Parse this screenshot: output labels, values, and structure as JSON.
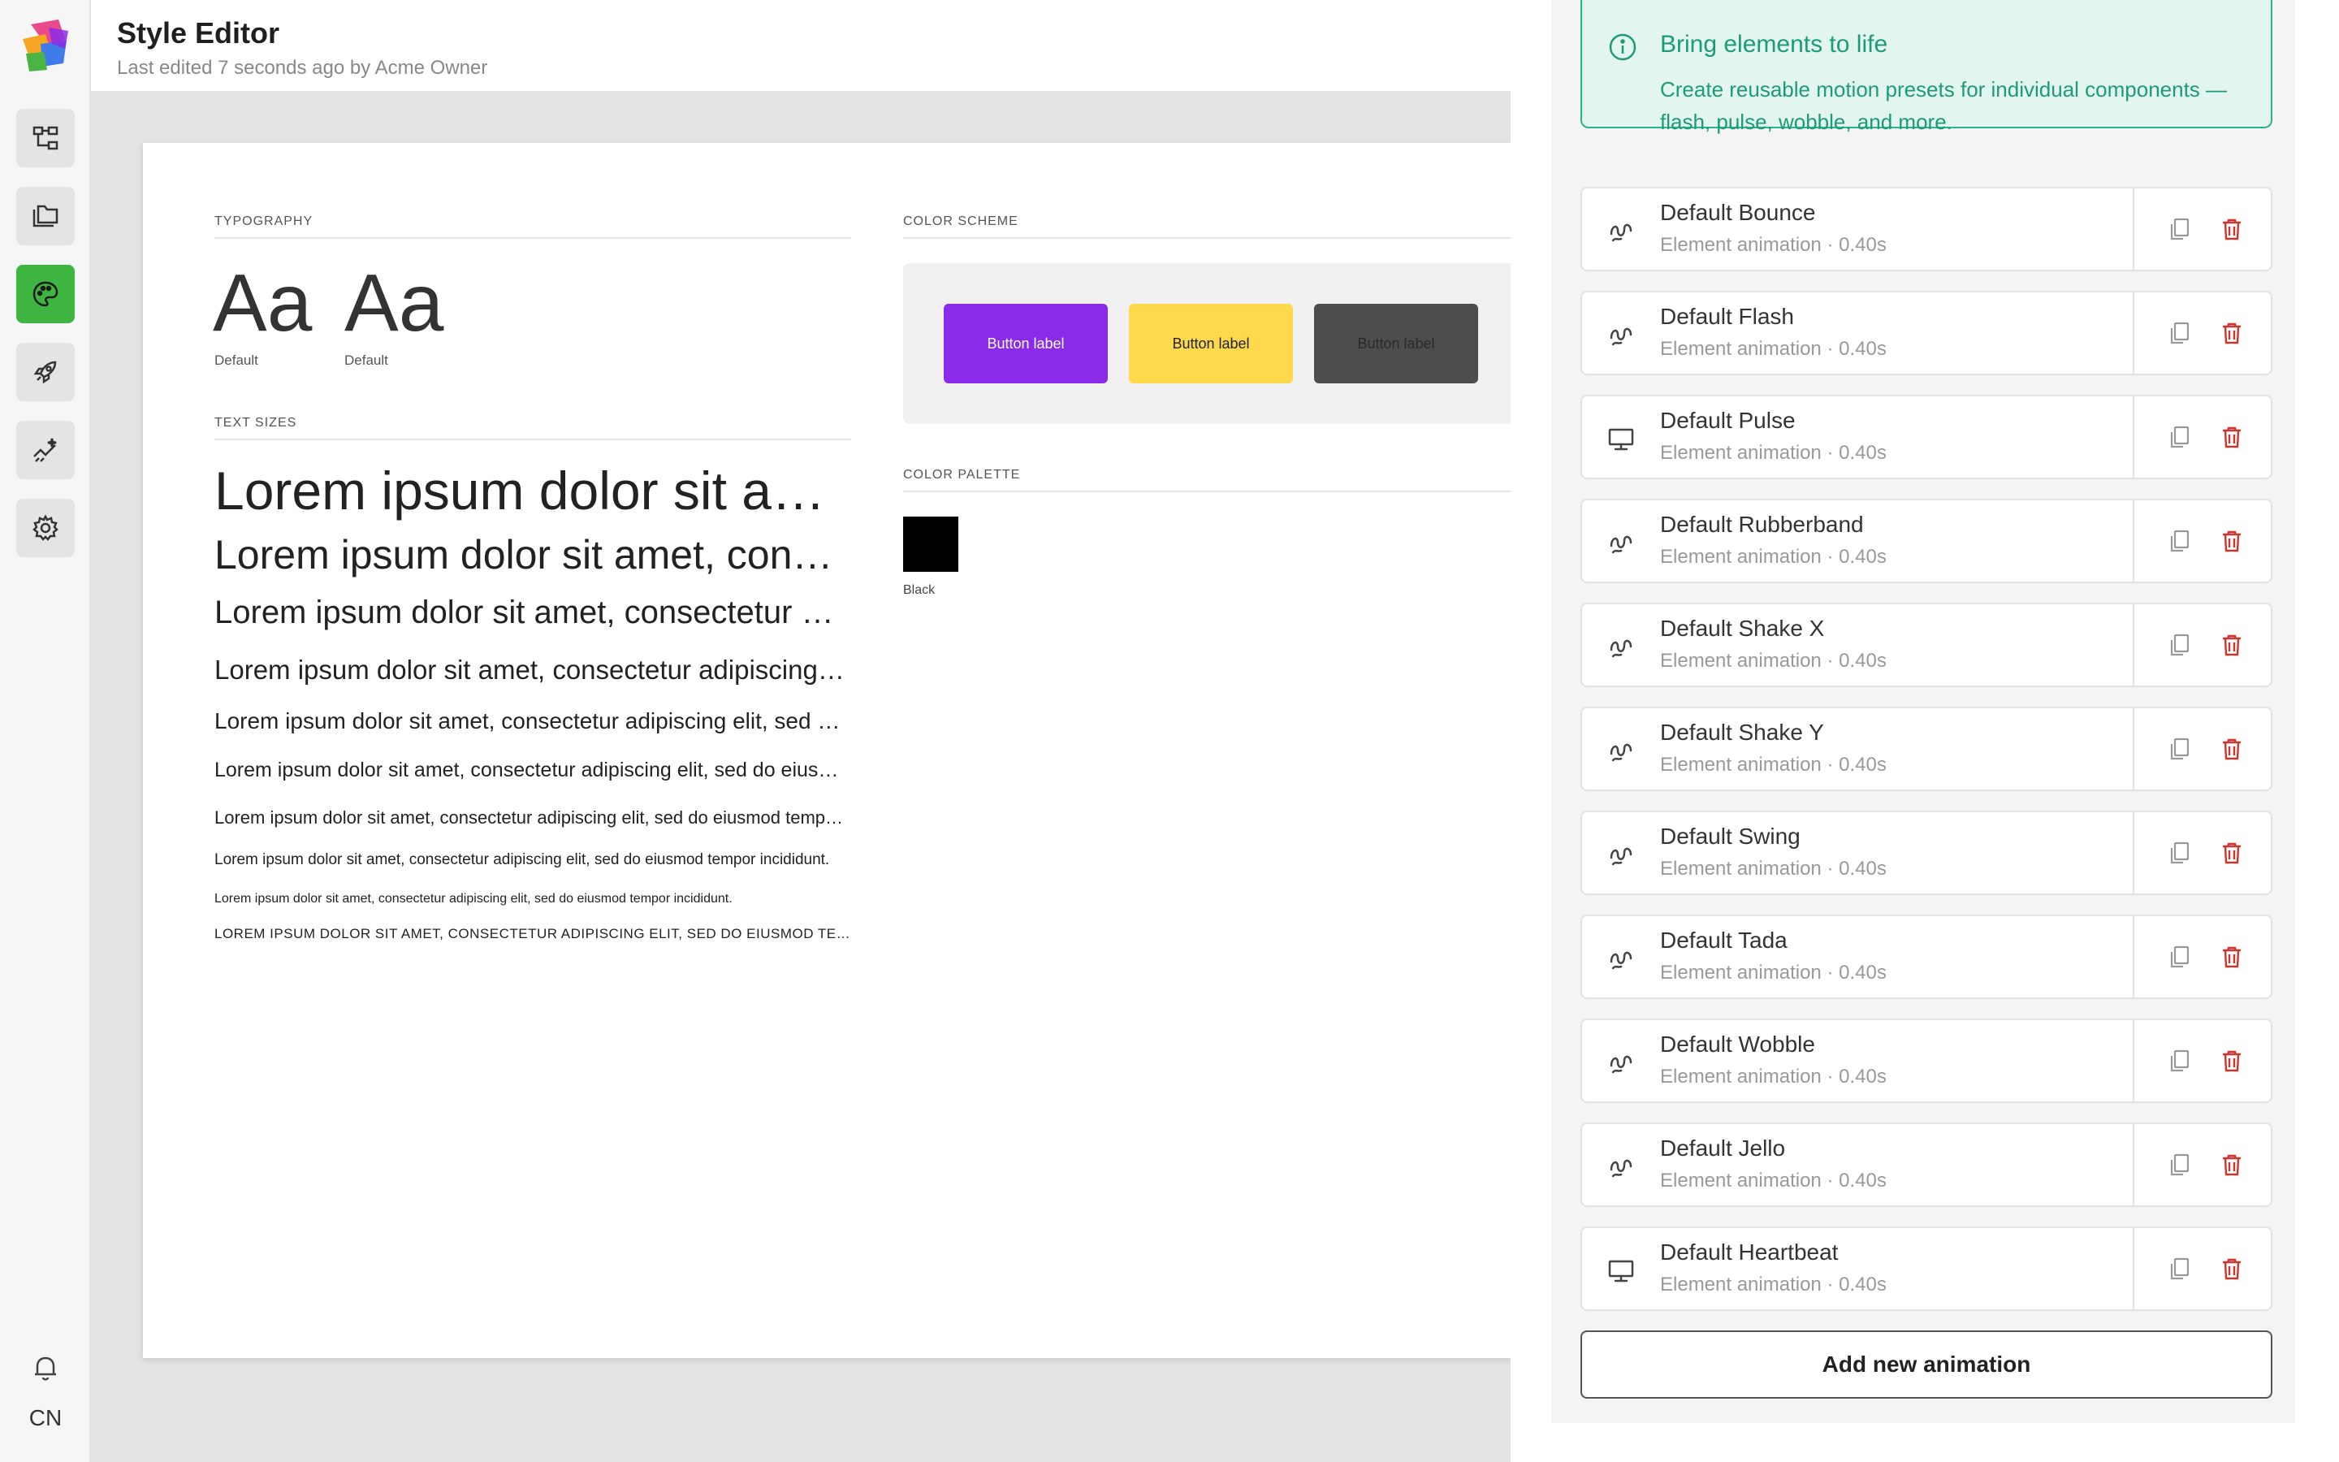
{
  "header": {
    "title": "Style Editor",
    "subtitle": "Last edited 7 seconds ago by Acme Owner"
  },
  "sidebar": {
    "items": [
      {
        "icon": "sitemap-icon"
      },
      {
        "icon": "folders-icon"
      },
      {
        "icon": "palette-icon",
        "active": true
      },
      {
        "icon": "rocket-icon"
      },
      {
        "icon": "sparkle-chart-icon"
      },
      {
        "icon": "gear-icon"
      }
    ],
    "language": "CN"
  },
  "sheet": {
    "typography_label": "TYPOGRAPHY",
    "fonts": [
      {
        "sample": "Aa",
        "caption": "Default"
      },
      {
        "sample": "Aa",
        "caption": "Default"
      }
    ],
    "text_sizes_label": "TEXT SIZES",
    "text_sizes": [
      "Lorem ipsum dolor sit amet, consectetur adipiscing elit, sed do eiusmod tempor incididunt.",
      "Lorem ipsum dolor sit amet, consectetur adipiscing elit, sed do eiusmod tempor incididunt.",
      "Lorem ipsum dolor sit amet, consectetur adipiscing elit, sed do eiusmod tempor incididunt.",
      "Lorem ipsum dolor sit amet, consectetur adipiscing elit, sed do eiusmod tempor incididunt.",
      "Lorem ipsum dolor sit amet, consectetur adipiscing elit, sed do eiusmod tempor incididunt.",
      "Lorem ipsum dolor sit amet, consectetur adipiscing elit, sed do eiusmod tempor incididunt.",
      "Lorem ipsum dolor sit amet, consectetur adipiscing elit, sed do eiusmod tempor incididunt.",
      "Lorem ipsum dolor sit amet, consectetur adipiscing elit, sed do eiusmod tempor incididunt.",
      "Lorem ipsum dolor sit amet, consectetur adipiscing elit, sed do eiusmod tempor incididunt.",
      "LOREM IPSUM DOLOR SIT AMET, CONSECTETUR ADIPISCING ELIT, SED DO EIUSMOD TEMPOR INCIDIDUNT."
    ],
    "color_scheme_label": "COLOR SCHEME",
    "scheme_buttons": [
      {
        "label": "Button label",
        "bg": "#8a2be9",
        "fg": "#ffffff"
      },
      {
        "label": "Button label",
        "bg": "#fed94c",
        "fg": "#222222"
      },
      {
        "label": "Button label",
        "bg": "#4d4d4d",
        "fg": "#2a2a2a"
      }
    ],
    "color_palette_label": "COLOR PALETTE",
    "palette": [
      {
        "name": "Black",
        "color": "#000000"
      }
    ]
  },
  "panel": {
    "info_title": "Bring elements to life",
    "info_desc": "Create reusable motion presets for individual components — flash, pulse, wobble, and more.",
    "animations": [
      {
        "name": "Default Bounce",
        "meta": "Element animation · 0.40s",
        "icon": "squiggle-icon"
      },
      {
        "name": "Default Flash",
        "meta": "Element animation · 0.40s",
        "icon": "squiggle-icon"
      },
      {
        "name": "Default Pulse",
        "meta": "Element animation · 0.40s",
        "icon": "monitor-icon"
      },
      {
        "name": "Default Rubberband",
        "meta": "Element animation · 0.40s",
        "icon": "squiggle-icon"
      },
      {
        "name": "Default Shake X",
        "meta": "Element animation · 0.40s",
        "icon": "squiggle-icon"
      },
      {
        "name": "Default Shake Y",
        "meta": "Element animation · 0.40s",
        "icon": "squiggle-icon"
      },
      {
        "name": "Default Swing",
        "meta": "Element animation · 0.40s",
        "icon": "squiggle-icon"
      },
      {
        "name": "Default Tada",
        "meta": "Element animation · 0.40s",
        "icon": "squiggle-icon"
      },
      {
        "name": "Default Wobble",
        "meta": "Element animation · 0.40s",
        "icon": "squiggle-icon"
      },
      {
        "name": "Default Jello",
        "meta": "Element animation · 0.40s",
        "icon": "squiggle-icon"
      },
      {
        "name": "Default Heartbeat",
        "meta": "Element animation · 0.40s",
        "icon": "monitor-icon"
      }
    ],
    "add_button": "Add new animation"
  },
  "colors": {
    "accent_green": "#3fb541",
    "info_teal": "#1c9b78",
    "danger_red": "#d0352b"
  }
}
